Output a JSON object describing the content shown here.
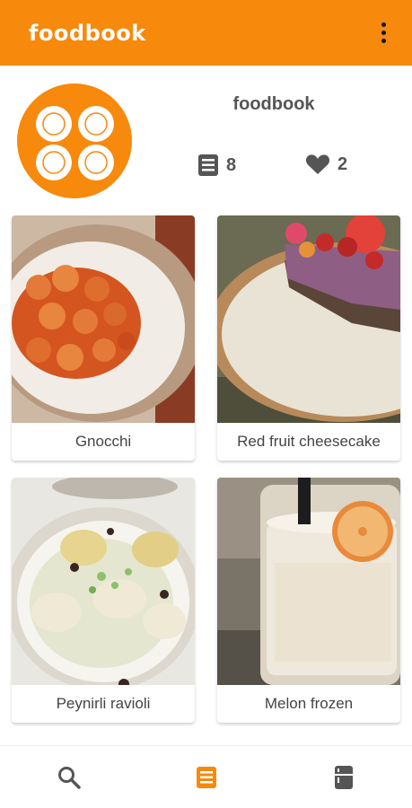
{
  "app": {
    "title": "foodbook"
  },
  "profile": {
    "name": "foodbook",
    "recipes_count": "8",
    "likes_count": "2",
    "recipes_icon": "recipe-book-icon",
    "likes_icon": "heart-icon"
  },
  "recipes": [
    {
      "name": "Gnocchi"
    },
    {
      "name": "Red fruit cheesecake"
    },
    {
      "name": "Peynirli ravioli"
    },
    {
      "name": "Melon frozen"
    }
  ],
  "bottom_nav": [
    {
      "icon": "search-icon",
      "active": false
    },
    {
      "icon": "recipe-book-icon",
      "active": true
    },
    {
      "icon": "fridge-icon",
      "active": false
    }
  ],
  "colors": {
    "accent": "#f7890c",
    "icon_inactive": "#555555"
  }
}
